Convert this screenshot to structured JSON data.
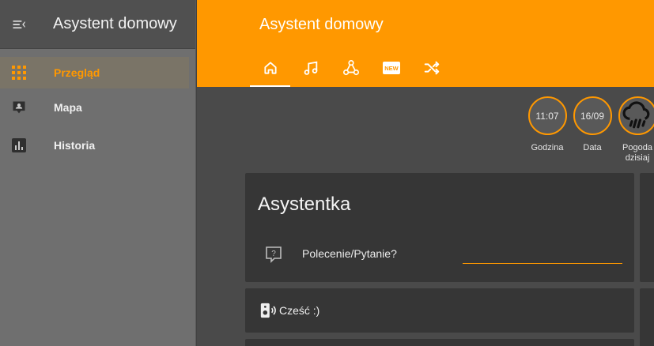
{
  "sidebar": {
    "title": "Asystent domowy",
    "items": [
      {
        "label": "Przegląd",
        "icon": "grid-icon",
        "active": true
      },
      {
        "label": "Mapa",
        "icon": "map-pin-icon",
        "active": false
      },
      {
        "label": "Historia",
        "icon": "chart-icon",
        "active": false
      }
    ]
  },
  "header": {
    "title": "Asystent domowy",
    "tabs": [
      {
        "icon": "home-icon",
        "active": true
      },
      {
        "icon": "music-note-icon",
        "active": false
      },
      {
        "icon": "hub-icon",
        "active": false
      },
      {
        "icon": "new-badge-icon",
        "active": false,
        "text": "NEW"
      },
      {
        "icon": "shuffle-icon",
        "active": false
      }
    ]
  },
  "badges": [
    {
      "value": "11:07",
      "label": "Godzina"
    },
    {
      "value": "16/09",
      "label": "Data"
    },
    {
      "value": "",
      "label": "Pogoda dzisiaj",
      "icon": "rain-cloud-icon"
    }
  ],
  "assistant": {
    "title": "Asystentka",
    "question_label": "Polecenie/Pytanie?",
    "input_value": ""
  },
  "greeting": {
    "text": "Cześć :)"
  },
  "colors": {
    "accent": "#ff9800",
    "sidebar": "#6f6f6f",
    "card": "#363636",
    "background": "#4a4a4a"
  }
}
